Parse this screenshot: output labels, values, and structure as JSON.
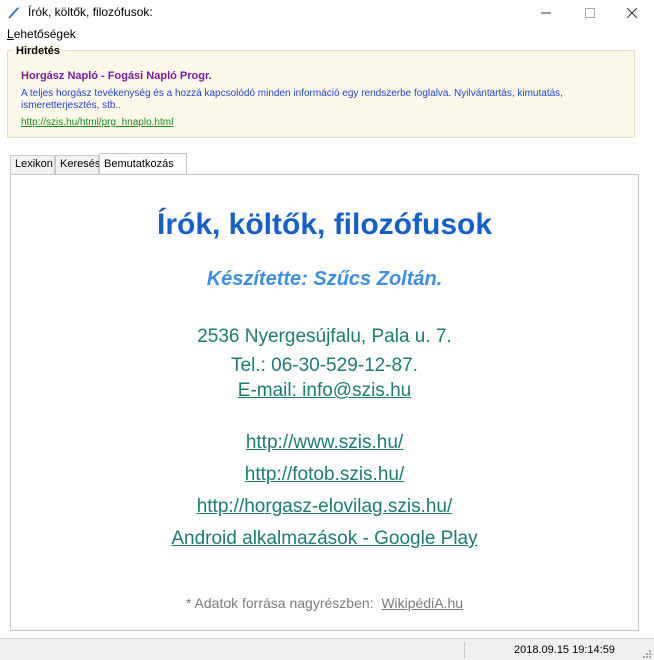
{
  "window": {
    "title": "Írók, költők, filozófusok:",
    "icon": "feather-pen-icon",
    "controls": {
      "minimize": "—",
      "maximize": "☐",
      "close": "✕"
    }
  },
  "menu": {
    "items": [
      {
        "label_u": "L",
        "label_rest": "ehetőségek"
      }
    ]
  },
  "ad": {
    "legend": "Hirdetés",
    "title": "Horgász Napló - Fogási Napló Progr.",
    "description": "A teljes horgász tevékenység és a hozzá kapcsolódó minden információ egy rendszerbe foglalva. Nyilvántartás, kimutatás, ismeretterjesztés, stb..",
    "link": "http://szis.hu/html/prg_hnaplo.html"
  },
  "tabs": [
    {
      "label": "Lexikon",
      "active": false
    },
    {
      "label": "Keresés",
      "active": false
    },
    {
      "label": "Bemutatkozás",
      "active": true
    }
  ],
  "about": {
    "title": "Írók, költők, filozófusok",
    "author": "Készítette: Szűcs Zoltán.",
    "address": "2536 Nyergesújfalu, Pala u. 7.",
    "phone": "Tel.: 06-30-529-12-87.",
    "email": "E-mail: info@szis.hu",
    "links": [
      "http://www.szis.hu/",
      "http://fotob.szis.hu/",
      "http://horgasz-elovilag.szis.hu/",
      "Android alkalmazások - Google Play "
    ],
    "source_prefix": "* Adatok forrása nagyrészben:  ",
    "source_name": "WikipédiA.hu"
  },
  "status": {
    "datetime": "2018.09.15 19:14:59"
  },
  "colors": {
    "title_blue": "#1560c8",
    "author_blue": "#3d8ee8",
    "teal_text": "#1e7a72",
    "ad_title_purple": "#7a1b9e",
    "ad_desc_blue": "#2244cc",
    "ad_link_green": "#1c8a1c",
    "ad_background": "#fdf9ea"
  }
}
